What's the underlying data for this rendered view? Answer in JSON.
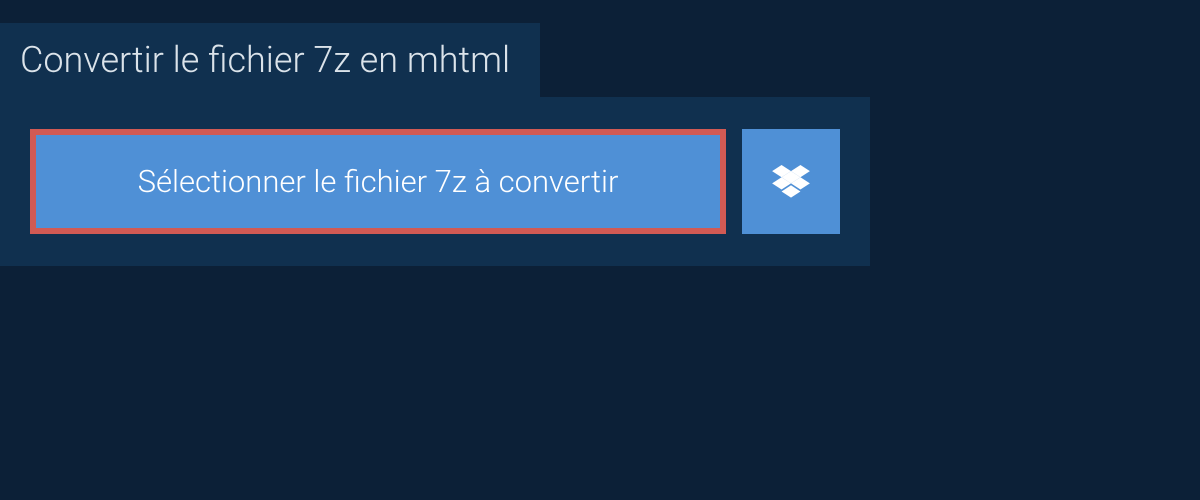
{
  "header": {
    "title": "Convertir le fichier 7z en mhtml"
  },
  "converter": {
    "select_button_label": "Sélectionner le fichier 7z à convertir"
  },
  "colors": {
    "page_bg": "#0c2037",
    "panel_bg": "#10304f",
    "button_bg": "#4f90d6",
    "highlight_border": "#d15a54",
    "title_text": "#dbe3ea",
    "button_text": "#ffffff"
  }
}
